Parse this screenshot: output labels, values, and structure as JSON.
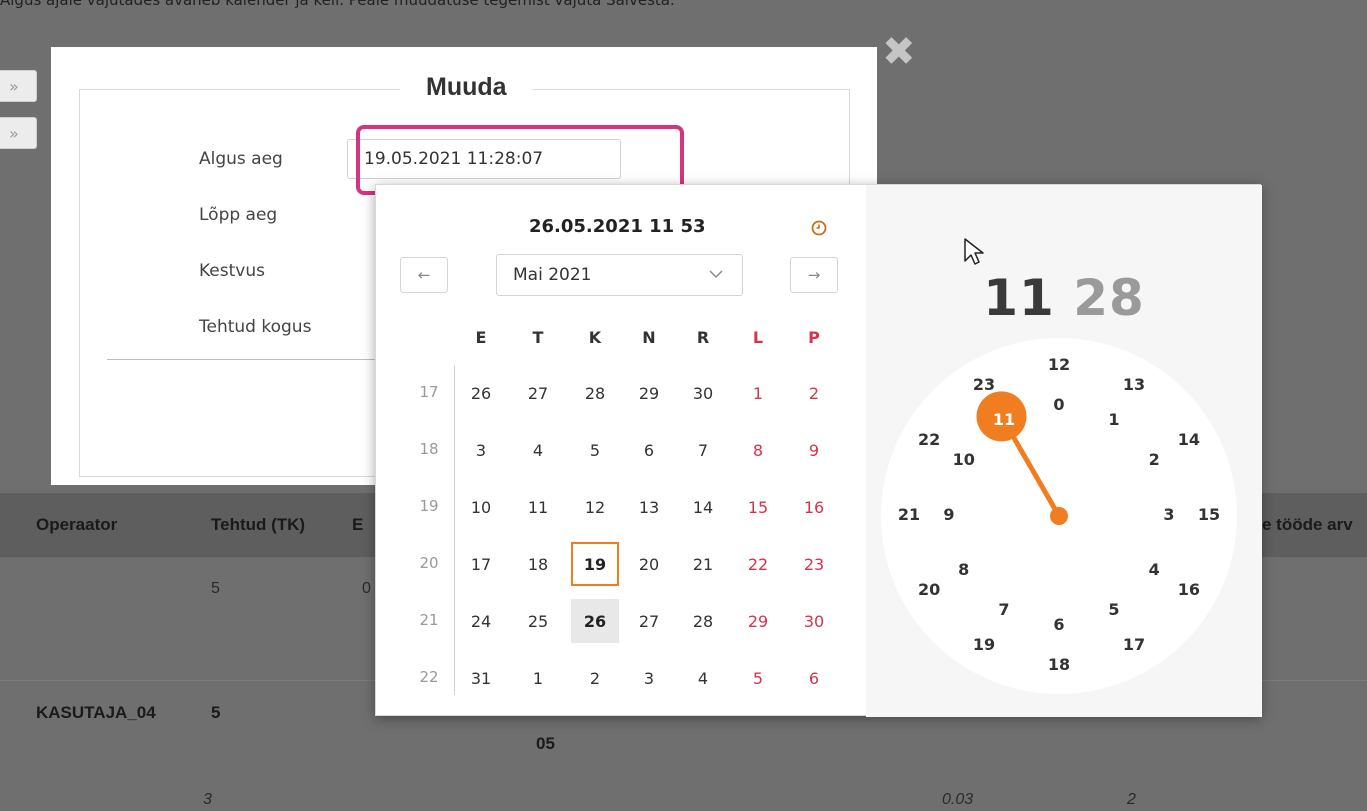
{
  "page": {
    "top_caption": "Algus ajale vajutades avaneb kalender ja kell. Peale muudatuse tegemist vajuta Salvesta."
  },
  "sidebar": {
    "collapse_icon": "double-chevron-right-icon",
    "glyph": "»"
  },
  "background_table": {
    "headers": [
      "Operaator",
      "Tehtud (TK)",
      "E",
      "e tööde arv"
    ],
    "rows": [
      {
        "tehtud": "5",
        "col3": "0"
      },
      {
        "operaator": "KASUTAJA_04",
        "tehtud": "5",
        "extra_line": "05"
      },
      {
        "tehtud": "3",
        "value_a": "0.03",
        "value_b": "2"
      }
    ]
  },
  "modal": {
    "title": "Muuda",
    "close_glyph": "✖",
    "fields": [
      {
        "label": "Algus aeg"
      },
      {
        "label": "Lõpp aeg"
      },
      {
        "label": "Kestvus"
      },
      {
        "label": "Tehtud kogus"
      }
    ],
    "algus_value": "19.05.2021 11:28:07"
  },
  "picker": {
    "header_datetime": "26.05.2021 11 53",
    "clock_toggle_icon": "clock-icon",
    "prev_label": "←",
    "next_label": "→",
    "month_label": "Mai 2021",
    "month_chevron_icon": "chevron-down-icon",
    "weekdays": [
      "E",
      "T",
      "K",
      "N",
      "R",
      "L",
      "P"
    ],
    "weeks": [
      {
        "num": "17",
        "days": [
          "26",
          "27",
          "28",
          "29",
          "30",
          "1",
          "2"
        ]
      },
      {
        "num": "18",
        "days": [
          "3",
          "4",
          "5",
          "6",
          "7",
          "8",
          "9"
        ]
      },
      {
        "num": "19",
        "days": [
          "10",
          "11",
          "12",
          "13",
          "14",
          "15",
          "16"
        ]
      },
      {
        "num": "20",
        "days": [
          "17",
          "18",
          "19",
          "20",
          "21",
          "22",
          "23"
        ]
      },
      {
        "num": "21",
        "days": [
          "24",
          "25",
          "26",
          "27",
          "28",
          "29",
          "30"
        ]
      },
      {
        "num": "22",
        "days": [
          "31",
          "1",
          "2",
          "3",
          "4",
          "5",
          "6"
        ]
      }
    ],
    "selected_day": "19",
    "today_day": "26",
    "time": {
      "hour": "11",
      "minute": "28"
    },
    "clock_outer": [
      "12",
      "13",
      "14",
      "15",
      "16",
      "17",
      "18",
      "19",
      "20",
      "21",
      "22",
      "23"
    ],
    "clock_inner": [
      "0",
      "1",
      "2",
      "3",
      "4",
      "5",
      "6",
      "7",
      "8",
      "9",
      "10",
      "11"
    ],
    "clock_selected_hour": "11",
    "accent_color": "#f07d1f",
    "weekend_color": "#d6334c",
    "highlight_color": "#d6357e"
  }
}
